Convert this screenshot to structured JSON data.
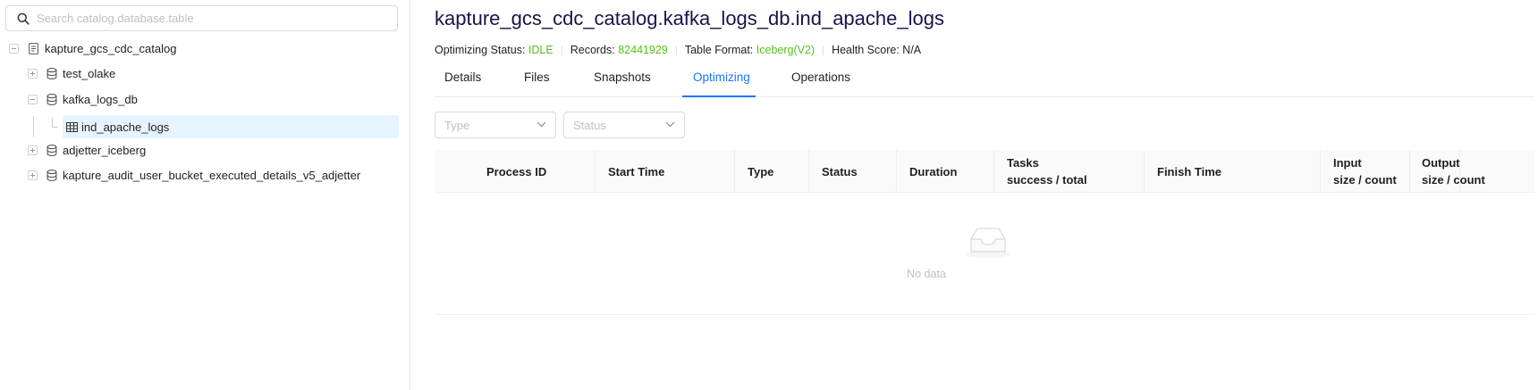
{
  "search": {
    "placeholder": "Search catalog.database.table"
  },
  "tree": {
    "catalog": "kapture_gcs_cdc_catalog",
    "databases": [
      {
        "label": "test_olake"
      },
      {
        "label": "kafka_logs_db"
      },
      {
        "label": "adjetter_iceberg"
      },
      {
        "label": "kapture_audit_user_bucket_executed_details_v5_adjetter"
      }
    ],
    "selected_table": "ind_apache_logs"
  },
  "header": {
    "title": "kapture_gcs_cdc_catalog.kafka_logs_db.ind_apache_logs",
    "optimizing_status_label": "Optimizing Status:",
    "optimizing_status_value": "IDLE",
    "records_label": "Records:",
    "records_value": "82441929",
    "table_format_label": "Table Format:",
    "table_format_value": "Iceberg(V2)",
    "health_score_label": "Health Score:",
    "health_score_value": "N/A"
  },
  "tabs": [
    {
      "label": "Details"
    },
    {
      "label": "Files"
    },
    {
      "label": "Snapshots"
    },
    {
      "label": "Optimizing",
      "active": true
    },
    {
      "label": "Operations"
    }
  ],
  "filters": {
    "type_placeholder": "Type",
    "status_placeholder": "Status"
  },
  "table": {
    "columns": [
      {
        "line1": "Process ID",
        "line2": ""
      },
      {
        "line1": "Start Time",
        "line2": ""
      },
      {
        "line1": "Type",
        "line2": ""
      },
      {
        "line1": "Status",
        "line2": ""
      },
      {
        "line1": "Duration",
        "line2": ""
      },
      {
        "line1": "Tasks",
        "line2": "success / total"
      },
      {
        "line1": "Finish Time",
        "line2": ""
      },
      {
        "line1": "Input",
        "line2": "size / count"
      },
      {
        "line1": "Output",
        "line2": "size / count"
      }
    ],
    "empty_text": "No data"
  },
  "colors": {
    "accent": "#1677ff",
    "success": "#52c41a",
    "selected_bg": "#e6f4ff",
    "title": "#14154a"
  },
  "icons": [
    "search-icon",
    "catalog-icon",
    "database-icon",
    "table-icon",
    "chevron-down-icon",
    "empty-box-icon"
  ]
}
